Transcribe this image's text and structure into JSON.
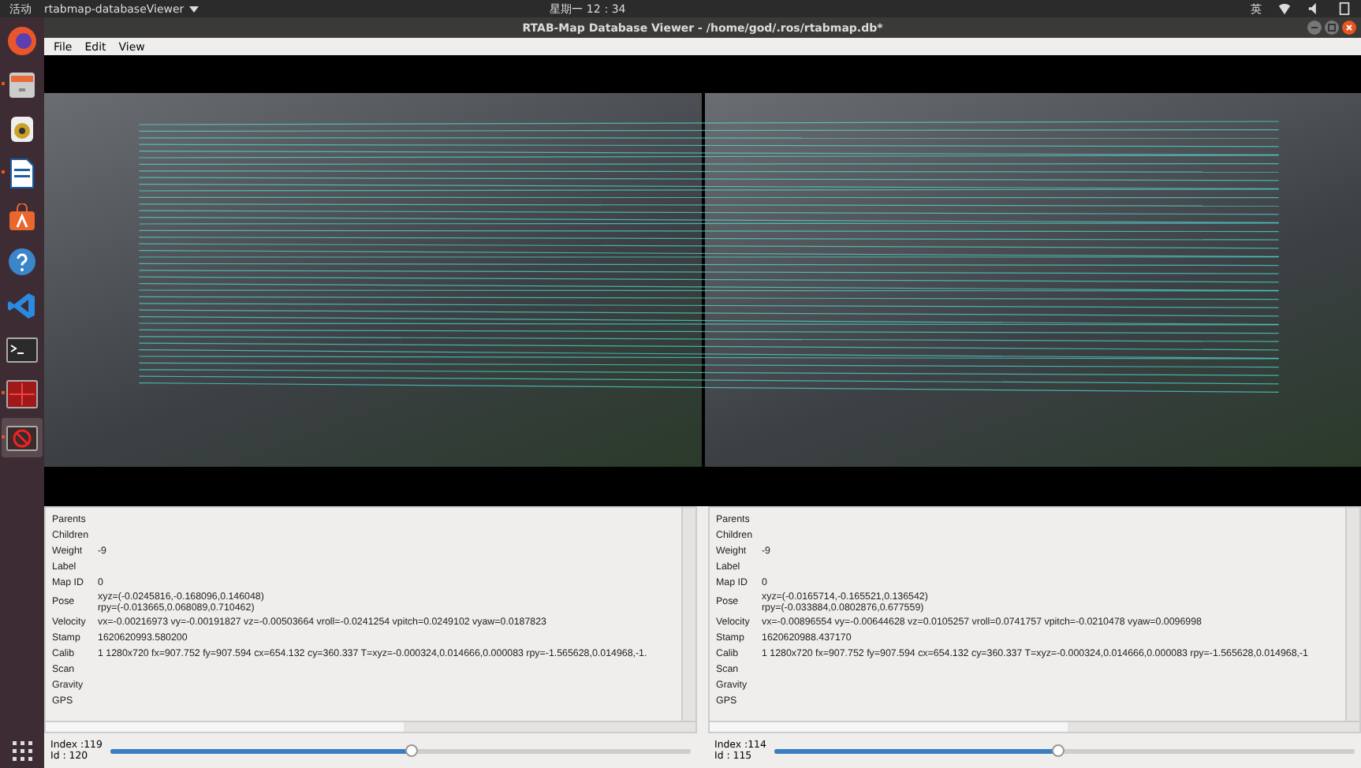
{
  "top_bar": {
    "activities": "活动",
    "app_menu": "rtabmap-databaseViewer",
    "clock": "星期一 12：34",
    "input_method": "英"
  },
  "dock": {
    "items": [
      {
        "kind": "firefox",
        "running": false
      },
      {
        "kind": "files",
        "running": true
      },
      {
        "kind": "speaker",
        "running": false
      },
      {
        "kind": "writer",
        "running": true
      },
      {
        "kind": "store",
        "running": false
      },
      {
        "kind": "help",
        "running": false
      },
      {
        "kind": "code",
        "running": false
      },
      {
        "kind": "terminal",
        "running": false
      },
      {
        "kind": "monitor",
        "running": true
      },
      {
        "kind": "viewer",
        "running": true
      }
    ]
  },
  "window": {
    "title": "RTAB-Map Database Viewer - /home/god/.ros/rtabmap.db*"
  },
  "menu": [
    "File",
    "Edit",
    "View"
  ],
  "panels": [
    {
      "rows": [
        {
          "label": "Parents",
          "value": ""
        },
        {
          "label": "Children",
          "value": ""
        },
        {
          "label": "Weight",
          "value": "-9"
        },
        {
          "label": "Label",
          "value": ""
        },
        {
          "label": "Map ID",
          "value": "0"
        },
        {
          "label": "Pose",
          "value": "xyz=(-0.0245816,-0.168096,0.146048)",
          "value_2": "rpy=(-0.013665,0.068089,0.710462)"
        },
        {
          "label": "Velocity",
          "value": "vx=-0.00216973 vy=-0.00191827 vz=-0.00503664 vroll=-0.0241254 vpitch=0.0249102 vyaw=0.0187823"
        },
        {
          "label": "Stamp",
          "value": "1620620993.580200"
        },
        {
          "label": "Calib",
          "value": "1 1280x720 fx=907.752 fy=907.594 cx=654.132 cy=360.337 T=xyz=-0.000324,0.014666,0.000083 rpy=-1.565628,0.014968,-1."
        },
        {
          "label": "Scan",
          "value": ""
        },
        {
          "label": "Gravity",
          "value": ""
        },
        {
          "label": "GPS",
          "value": ""
        }
      ],
      "index_label": "Index :",
      "index": "119",
      "id_label": "Id :",
      "id": "120",
      "level": 0.52
    },
    {
      "rows": [
        {
          "label": "Parents",
          "value": ""
        },
        {
          "label": "Children",
          "value": ""
        },
        {
          "label": "Weight",
          "value": "-9"
        },
        {
          "label": "Label",
          "value": ""
        },
        {
          "label": "Map ID",
          "value": "0"
        },
        {
          "label": "Pose",
          "value": "xyz=(-0.0165714,-0.165521,0.136542)",
          "value_2": "rpy=(-0.033884,0.0802876,0.677559)"
        },
        {
          "label": "Velocity",
          "value": "vx=-0.00896554 vy=-0.00644628 vz=0.0105257 vroll=0.0741757 vpitch=-0.0210478 vyaw=0.0096998"
        },
        {
          "label": "Stamp",
          "value": "1620620988.437170"
        },
        {
          "label": "Calib",
          "value": "1 1280x720 fx=907.752 fy=907.594 cx=654.132 cy=360.337 T=xyz=-0.000324,0.014666,0.000083 rpy=-1.565628,0.014968,-1"
        },
        {
          "label": "Scan",
          "value": ""
        },
        {
          "label": "Gravity",
          "value": ""
        },
        {
          "label": "GPS",
          "value": ""
        }
      ],
      "index_label": "Index :",
      "index": "114",
      "id_label": "Id :",
      "id": "115",
      "level": 0.49
    }
  ]
}
